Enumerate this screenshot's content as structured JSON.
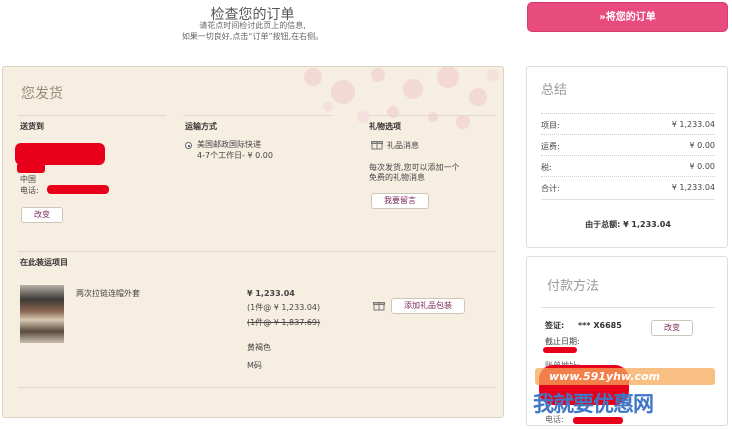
{
  "header": {
    "title": "检查您的订单",
    "sub_line1": "请花点时间检讨此页上的信息,",
    "sub_line2": "如果一切良好,点击“订单”按钮,在右侧。",
    "place_order": "»将您的订单"
  },
  "ship": {
    "title": "您发货",
    "ship_to": {
      "heading": "送货到",
      "country": "中国",
      "phone_label": "电话:",
      "change": "改变"
    },
    "shipping_method": {
      "heading": "运输方式",
      "option_line1": "美国邮政国际快递",
      "option_line2": "4-7个工作日- ¥ 0.00",
      "selected": true
    },
    "gift": {
      "heading": "礼物选项",
      "gift_message": "礼品消息",
      "desc_line1": "每次发货,您可以添加一个",
      "desc_line2": "免费的礼物消息",
      "add_note": "我要留言"
    },
    "items": {
      "heading": "在此装运项目",
      "list": [
        {
          "name": "两次拉链连帽外套",
          "price": "¥ 1,233.04",
          "qty_line": "(1件@ ¥ 1,233.04)",
          "orig_line": "(1件@ ¥ 1,837.69)",
          "color": "黄褐色",
          "size": "M码",
          "gift_wrap": "添加礼品包装"
        }
      ]
    }
  },
  "summary": {
    "title": "总结",
    "rows": [
      {
        "label": "项目:",
        "value": "¥ 1,233.04"
      },
      {
        "label": "运费:",
        "value": "¥ 0.00"
      },
      {
        "label": "税:",
        "value": "¥ 0.00"
      },
      {
        "label": "合计:",
        "value": "¥ 1,233.04"
      }
    ],
    "total": "由于总额: ¥ 1,233.04"
  },
  "payment": {
    "title": "付款方法",
    "card_label": "签证:",
    "card_number": "*** X6685",
    "change": "改变",
    "expiry_label": "截止日期:",
    "billing_label": "账单地址:",
    "phone_label": "电话:"
  },
  "watermark": {
    "url": "www.591yhw.com",
    "text": "我就要优惠网"
  },
  "colors": {
    "accent": "#e84b7d",
    "panel_bg": "#f7eee2",
    "redaction": "#e8001a"
  }
}
